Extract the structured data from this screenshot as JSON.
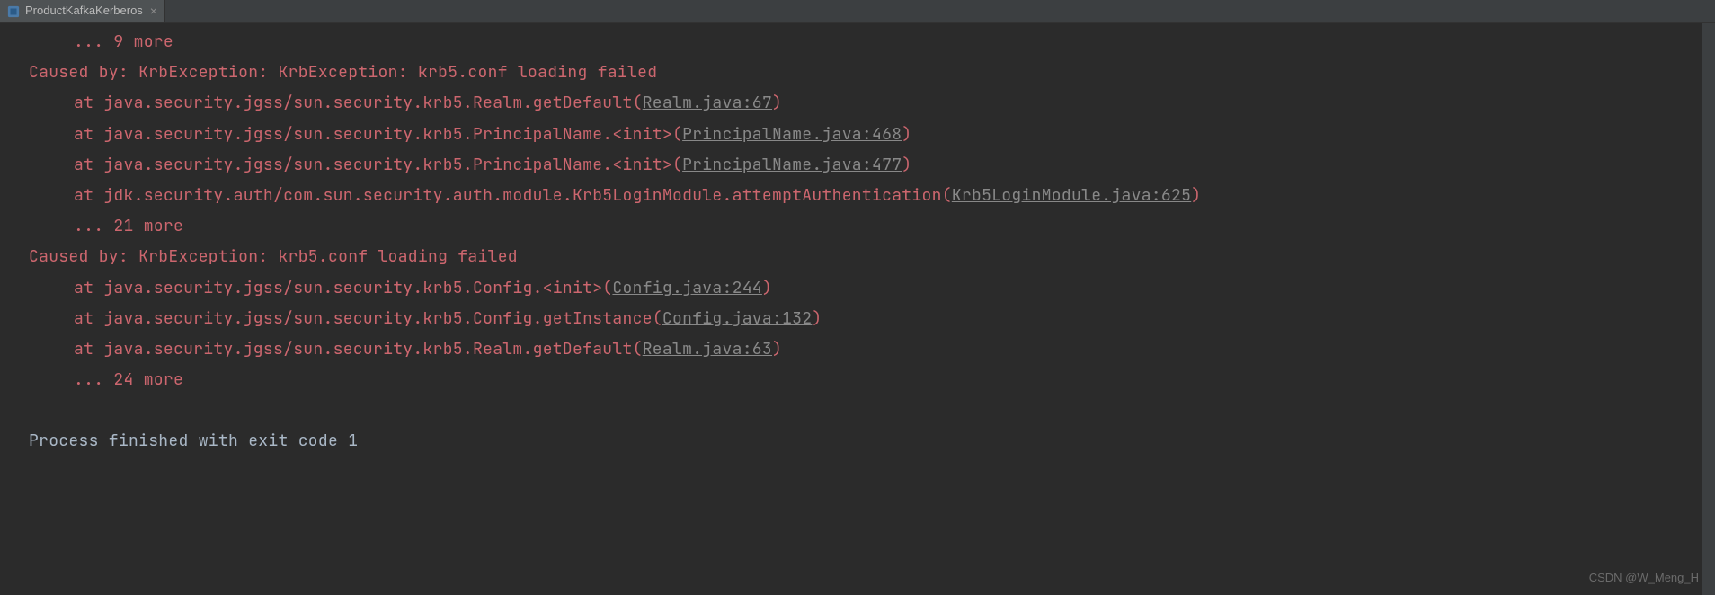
{
  "tab": {
    "title": "ProductKafkaKerberos",
    "close_glyph": "×"
  },
  "console": {
    "lines": [
      {
        "type": "err",
        "indent": 1,
        "text": "... 9 more"
      },
      {
        "type": "err",
        "indent": 0,
        "text": "Caused by: KrbException: KrbException: krb5.conf loading failed"
      },
      {
        "type": "stack",
        "indent": 1,
        "prefix": "at java.security.jgss/sun.security.krb5.Realm.getDefault(",
        "link": "Realm.java:67",
        "suffix": ")"
      },
      {
        "type": "stack",
        "indent": 1,
        "prefix": "at java.security.jgss/sun.security.krb5.PrincipalName.<init>(",
        "link": "PrincipalName.java:468",
        "suffix": ")"
      },
      {
        "type": "stack",
        "indent": 1,
        "prefix": "at java.security.jgss/sun.security.krb5.PrincipalName.<init>(",
        "link": "PrincipalName.java:477",
        "suffix": ")"
      },
      {
        "type": "stack",
        "indent": 1,
        "prefix": "at jdk.security.auth/com.sun.security.auth.module.Krb5LoginModule.attemptAuthentication(",
        "link": "Krb5LoginModule.java:625",
        "suffix": ")"
      },
      {
        "type": "err",
        "indent": 1,
        "text": "... 21 more"
      },
      {
        "type": "err",
        "indent": 0,
        "text": "Caused by: KrbException: krb5.conf loading failed"
      },
      {
        "type": "stack",
        "indent": 1,
        "prefix": "at java.security.jgss/sun.security.krb5.Config.<init>(",
        "link": "Config.java:244",
        "suffix": ")"
      },
      {
        "type": "stack",
        "indent": 1,
        "prefix": "at java.security.jgss/sun.security.krb5.Config.getInstance(",
        "link": "Config.java:132",
        "suffix": ")"
      },
      {
        "type": "stack",
        "indent": 1,
        "prefix": "at java.security.jgss/sun.security.krb5.Realm.getDefault(",
        "link": "Realm.java:63",
        "suffix": ")"
      },
      {
        "type": "err",
        "indent": 1,
        "text": "... 24 more"
      },
      {
        "type": "blank",
        "indent": 0,
        "text": " "
      },
      {
        "type": "plain",
        "indent": 0,
        "text": "Process finished with exit code 1"
      }
    ]
  },
  "watermark": "CSDN @W_Meng_H"
}
